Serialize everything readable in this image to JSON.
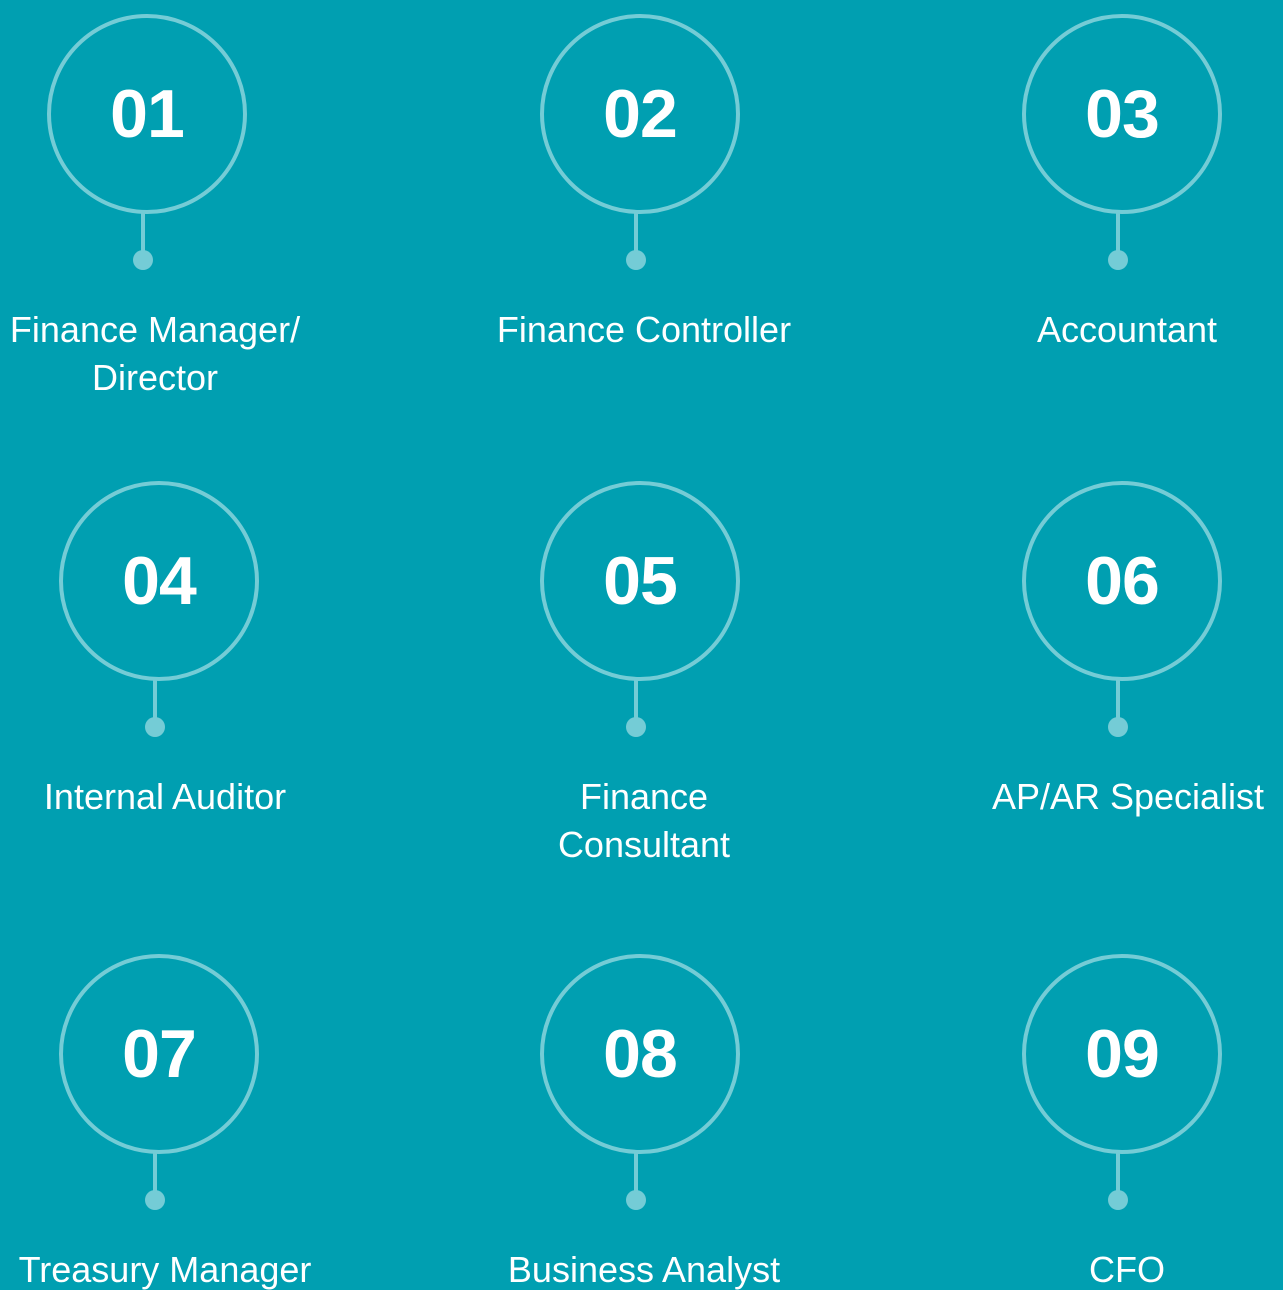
{
  "colors": {
    "background": "#009fb1",
    "accent": "#74ccd6",
    "text": "#ffffff"
  },
  "items": [
    {
      "number": "01",
      "title": "Finance Manager/ Director"
    },
    {
      "number": "02",
      "title": "Finance Controller"
    },
    {
      "number": "03",
      "title": "Accountant"
    },
    {
      "number": "04",
      "title": "Internal Auditor"
    },
    {
      "number": "05",
      "title": "Finance Consultant"
    },
    {
      "number": "06",
      "title": "AP/AR Specialist"
    },
    {
      "number": "07",
      "title": "Treasury Manager"
    },
    {
      "number": "08",
      "title": "Business Analyst"
    },
    {
      "number": "09",
      "title": "CFO"
    }
  ]
}
